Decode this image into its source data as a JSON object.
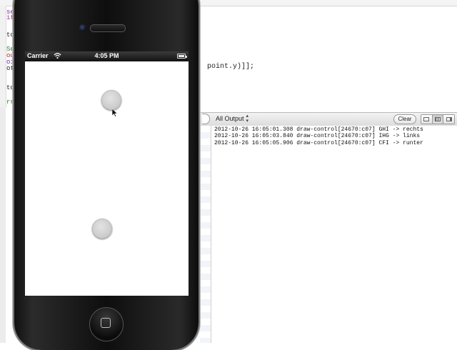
{
  "editor": {
    "code_line": "point.y)]];",
    "fragments": [
      {
        "text": "self",
        "color": "#6d2d9e"
      },
      {
        "text": "if",
        "color": "#a32a8f"
      },
      {
        "text": "to",
        "color": "#222222"
      },
      {
        "text": "Sen",
        "color": "#2a7a2a"
      },
      {
        "text": "ouc",
        "color": "#b02a2a"
      },
      {
        "text": "oin",
        "color": "#6d2d9e"
      },
      {
        "text": "oth",
        "color": "#222222"
      },
      {
        "text": "to",
        "color": "#222222"
      },
      {
        "text": "rr",
        "color": "#2a7a2a"
      }
    ]
  },
  "debug_bar": {
    "output_filter": "All Output",
    "clear_label": "Clear"
  },
  "console": {
    "lines": [
      "2012-10-26 16:05:01.308 draw-control[24670:c07] GHI -> rechts",
      "2012-10-26 16:05:03.840 draw-control[24670:c07] IHG -> links",
      "2012-10-26 16:05:05.906 draw-control[24670:c07] CFI -> runter"
    ]
  },
  "simulator": {
    "carrier": "Carrier",
    "time": "4:05 PM"
  },
  "icons": [
    "wifi-icon",
    "battery-icon",
    "home-button-icon",
    "cursor-icon",
    "layout-toggle-icon"
  ]
}
